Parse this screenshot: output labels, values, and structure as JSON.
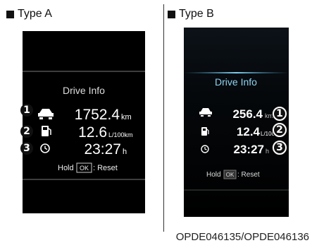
{
  "panels": [
    {
      "label": "Type A",
      "title": "Drive Info",
      "rows": [
        {
          "num": "1",
          "value": "1752.4",
          "unit": "km",
          "icon": "car-icon"
        },
        {
          "num": "2",
          "value": "12.6",
          "unit": "L/100km",
          "icon": "fuel-pump-icon"
        },
        {
          "num": "3",
          "value": "23:27",
          "unit": "h",
          "icon": "clock-icon"
        }
      ],
      "reset_prefix": "Hold",
      "reset_key": "OK",
      "reset_suffix": ": Reset"
    },
    {
      "label": "Type B",
      "title": "Drive Info",
      "rows": [
        {
          "num": "1",
          "value": "256.4",
          "unit": "km",
          "icon": "car-icon"
        },
        {
          "num": "2",
          "value": "12.4",
          "unit": "L/100k",
          "icon": "fuel-pump-icon"
        },
        {
          "num": "3",
          "value": "23:27",
          "unit": "h",
          "icon": "clock-icon"
        }
      ],
      "reset_prefix": "Hold",
      "reset_key": "OK",
      "reset_suffix": ": Reset"
    }
  ],
  "reference": "OPDE046135/OPDE046136"
}
